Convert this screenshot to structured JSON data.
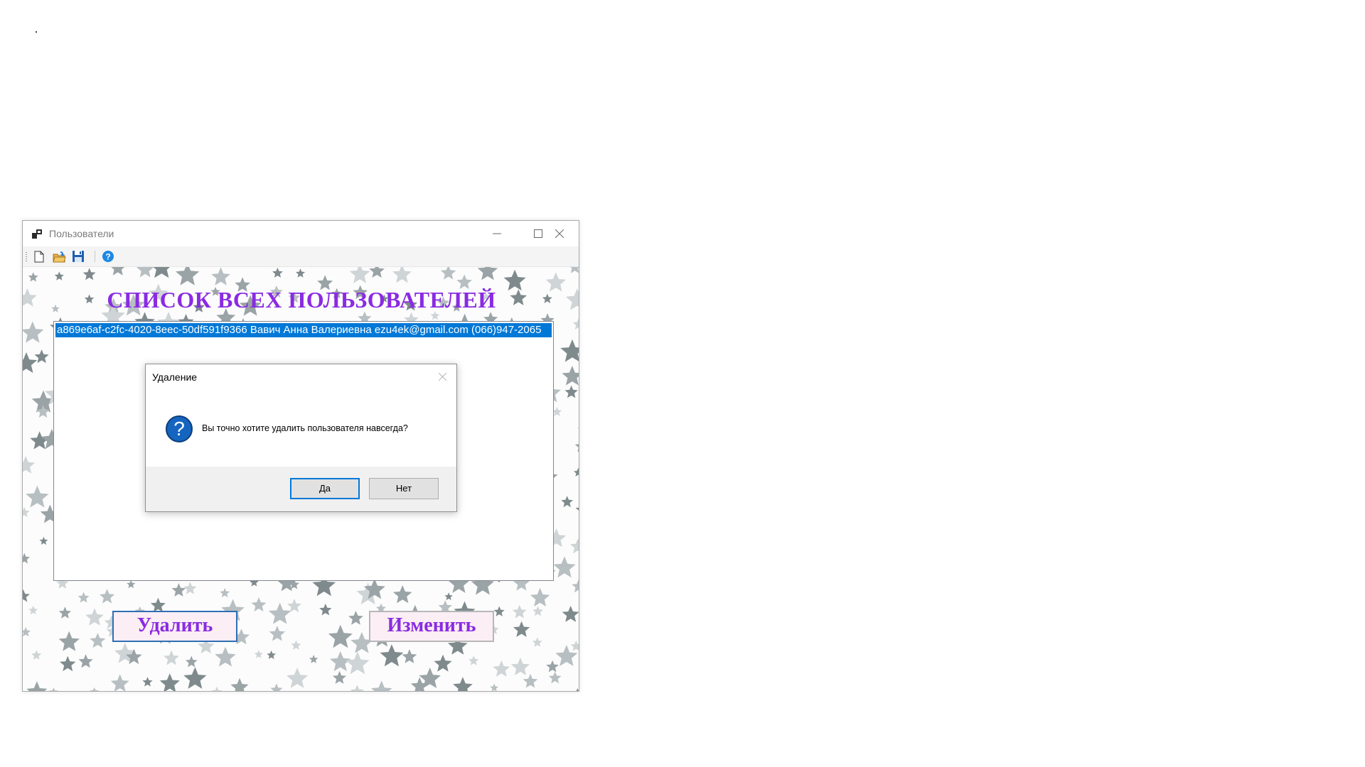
{
  "window": {
    "title": "Пользователи",
    "heading": "СПИСОК ВСЕХ ПОЛЬЗОВАТЕЛЕЙ",
    "toolbar_icons": [
      "new-file-icon",
      "open-folder-icon",
      "save-icon",
      "help-icon"
    ],
    "users": [
      "a869e6af-c2fc-4020-8eec-50df591f9366 Вавич Анна Валериевна ezu4ek@gmail.com (066)947-2065"
    ],
    "delete_label": "Удалить",
    "edit_label": "Изменить"
  },
  "dialog": {
    "title": "Удаление",
    "message": "Вы точно хотите удалить пользователя навсегда?",
    "yes_label": "Да",
    "no_label": "Нет",
    "icon": "question-icon"
  },
  "colors": {
    "accent_purple": "#8a2be2",
    "selection_blue": "#0078d7",
    "button_bg": "#fbeef4"
  }
}
